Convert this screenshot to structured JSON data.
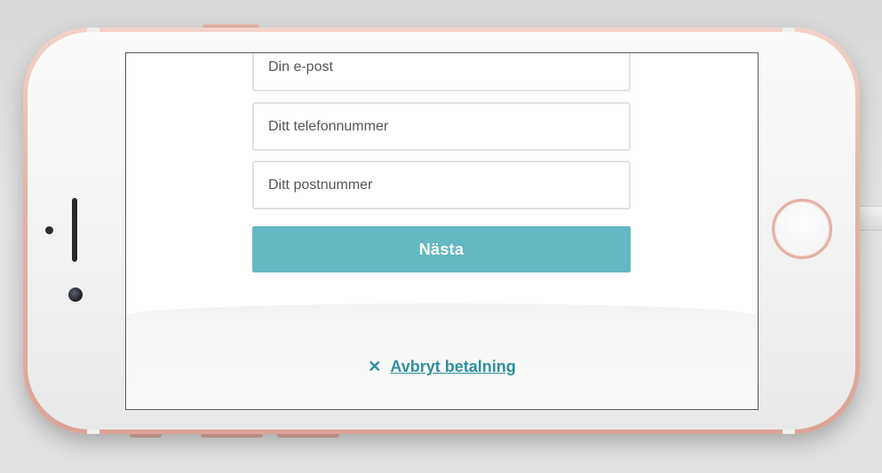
{
  "form": {
    "fields": [
      {
        "name": "email",
        "placeholder": "Din e-post"
      },
      {
        "name": "phone",
        "placeholder": "Ditt telefonnummer"
      },
      {
        "name": "postal",
        "placeholder": "Ditt postnummer"
      }
    ],
    "next_label": "Nästa"
  },
  "cancel": {
    "icon": "close-icon",
    "glyph": "✕",
    "label": "Avbryt betalning"
  },
  "colors": {
    "accent": "#63b8c3",
    "link": "#2e8f9e",
    "device_frame": "#e5b3a5"
  }
}
